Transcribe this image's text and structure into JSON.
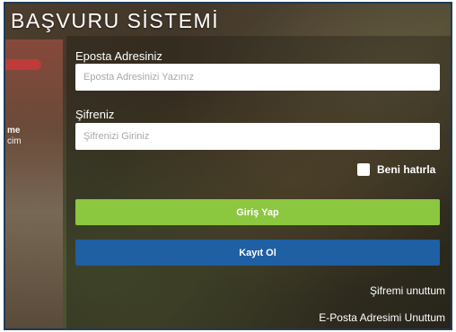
{
  "page": {
    "title": "BAŞVURU SİSTEMİ",
    "side_text_line1": "me",
    "side_text_line2": "cim"
  },
  "form": {
    "email_label": "Eposta Adresiniz",
    "email_placeholder": "Eposta Adresinizi Yazınız",
    "email_value": "",
    "password_label": "Şifreniz",
    "password_placeholder": "Şifrenizi Giriniz",
    "password_value": "",
    "remember_label": "Beni hatırla",
    "remember_checked": false,
    "login_button": "Giriş Yap",
    "register_button": "Kayıt Ol",
    "forgot_password_link": "Şifremi unuttum",
    "forgot_email_link": "E-Posta Adresimi Unuttum"
  },
  "colors": {
    "login_button": "#8cc740",
    "register_button": "#1f5fa3",
    "frame_border": "#1f3b57"
  }
}
